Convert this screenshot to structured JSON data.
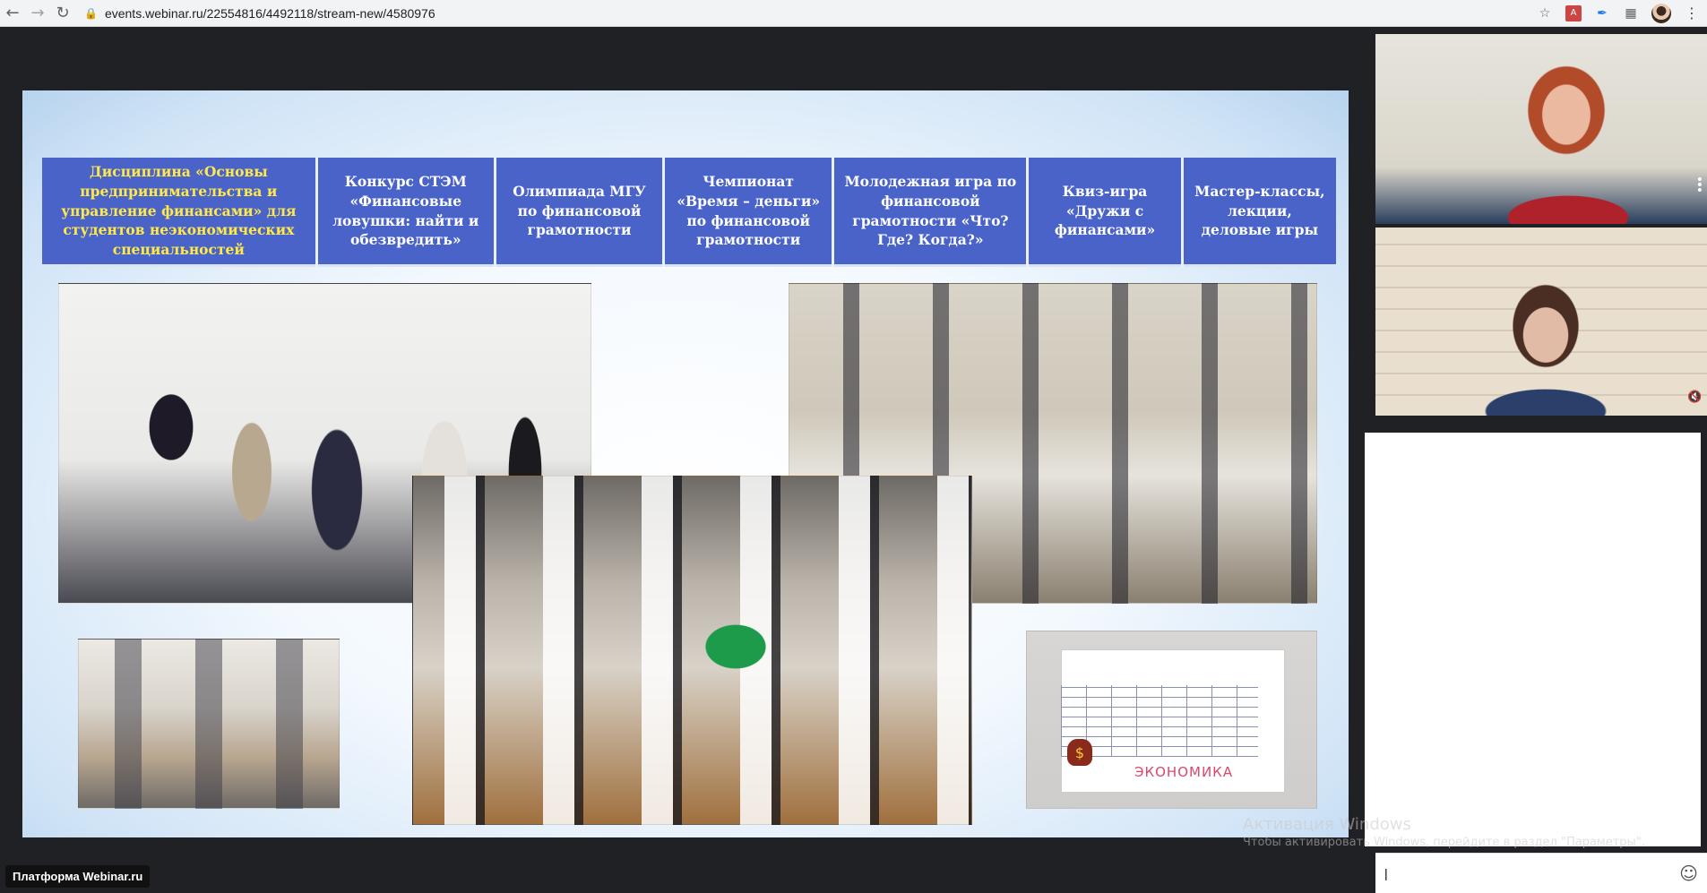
{
  "browser": {
    "url": "events.webinar.ru/22554816/4492118/stream-new/4580976"
  },
  "slide": {
    "categories": [
      "Дисциплина «Основы предпринимательства и управление финансами» для студентов неэкономических специальностей",
      "Конкурс СТЭМ «Финансовые ловушки: найти и обезвредить»",
      "Олимпиада МГУ по финансовой грамотности",
      "Чемпионат «Время – деньги» по финансовой грамотности",
      "Молодежная игра по финансовой грамотности «Что? Где? Когда?»",
      "Квиз-игра «Дружи с финансами»",
      "Мастер-классы, лекции, деловые игры"
    ],
    "poster_title": "ЭКОНОМИКА",
    "highlight_color": "#ffe94a",
    "cell_color": "#4a63c8"
  },
  "watermark": {
    "title": "Активация Windows",
    "subtitle": "Чтобы активировать Windows, перейдите в раздел \"Параметры\"."
  },
  "brand": "Платформа Webinar.ru",
  "chat": {
    "value": "|"
  }
}
